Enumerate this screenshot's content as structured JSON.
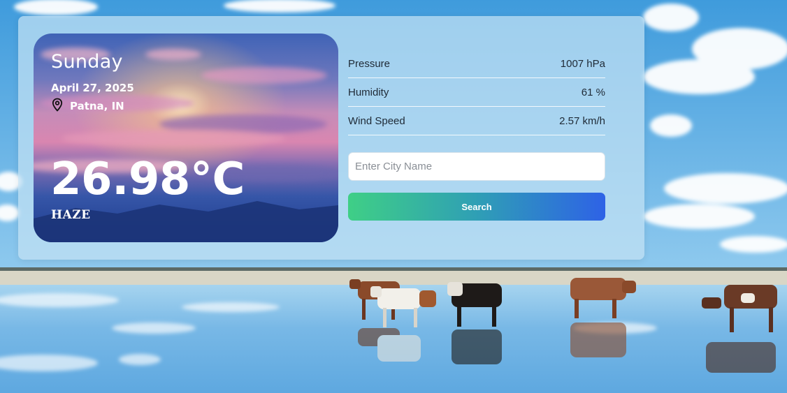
{
  "weather": {
    "day": "Sunday",
    "date": "April 27, 2025",
    "location": "Patna, IN",
    "temperature": "26.98°C",
    "condition": "HAZE"
  },
  "details": [
    {
      "label": "Pressure",
      "value": "1007 hPa"
    },
    {
      "label": "Humidity",
      "value": "61 %"
    },
    {
      "label": "Wind Speed",
      "value": "2.57 km/h"
    }
  ],
  "search": {
    "placeholder": "Enter City Name",
    "value": "",
    "button_label": "Search"
  },
  "icons": {
    "location": "location-pin-icon"
  },
  "colors": {
    "button_gradient_start": "#3fcf86",
    "button_gradient_end": "#2e62e6",
    "card_sky_top": "#3f63b6",
    "card_sky_pink": "#d786b3"
  }
}
